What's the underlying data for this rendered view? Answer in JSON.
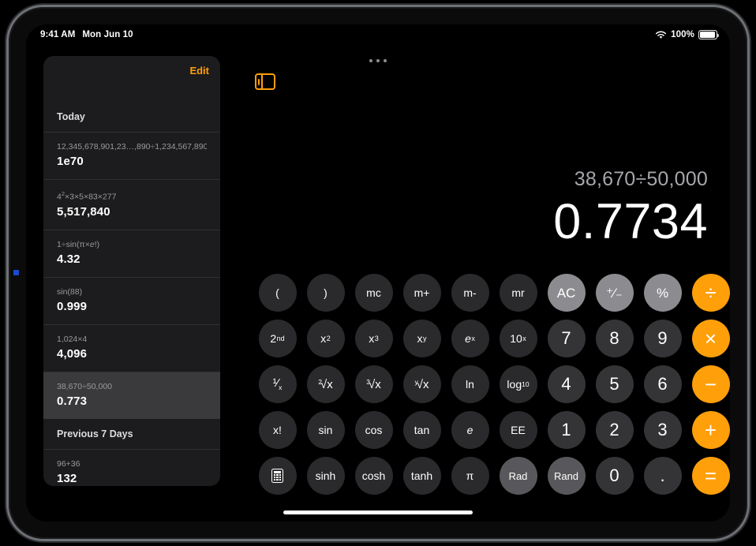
{
  "status_bar": {
    "time": "9:41 AM",
    "date": "Mon Jun 10",
    "wifi_icon": "wifi-icon",
    "battery_percent": "100%",
    "battery_icon": "battery-icon"
  },
  "multitask": {
    "icon": "multitasking-dots-icon"
  },
  "sidebar": {
    "edit_label": "Edit",
    "toggle_icon": "sidebar-toggle-icon",
    "sections": [
      {
        "title": "Today",
        "entries": [
          {
            "expression": "12,345,678,901,23…,890÷1,234,567,890",
            "result": "1e70",
            "selected": false
          },
          {
            "expression": "4²×3×5×83×277",
            "result": "5,517,840",
            "selected": false
          },
          {
            "expression": "1÷sin(π×e!)",
            "result": "4.32",
            "selected": false
          },
          {
            "expression": "sin(88)",
            "result": "0.999",
            "selected": false
          },
          {
            "expression": "1,024×4",
            "result": "4,096",
            "selected": false
          },
          {
            "expression": "38,670÷50,000",
            "result": "0.773",
            "selected": true
          }
        ]
      },
      {
        "title": "Previous 7 Days",
        "entries": [
          {
            "expression": "96+36",
            "result": "132",
            "selected": false
          }
        ]
      }
    ]
  },
  "display": {
    "expression": "38,670÷50,000",
    "result": "0.7734"
  },
  "colors": {
    "accent_orange": "#ff9f0a",
    "util_gray": "#8c8c90",
    "key_dark": "#2a2a2c",
    "digit_gray": "#343437",
    "sidebar_bg": "#1c1c1e",
    "row_selected": "#3a3a3c"
  },
  "keypad": {
    "rows": [
      [
        {
          "label": "(",
          "name": "key-open-paren",
          "style": "func"
        },
        {
          "label": ")",
          "name": "key-close-paren",
          "style": "func"
        },
        {
          "label": "mc",
          "name": "key-mc",
          "style": "func"
        },
        {
          "label": "m+",
          "name": "key-m-plus",
          "style": "func"
        },
        {
          "label": "m-",
          "name": "key-m-minus",
          "style": "func"
        },
        {
          "label": "mr",
          "name": "key-mr",
          "style": "func"
        },
        {
          "label": "AC",
          "name": "key-all-clear",
          "style": "util"
        },
        {
          "label": "⁺⁄₋",
          "name": "key-plus-minus",
          "style": "util"
        },
        {
          "label": "%",
          "name": "key-percent",
          "style": "util"
        },
        {
          "label": "÷",
          "name": "key-divide",
          "style": "op"
        }
      ],
      [
        {
          "label": "2nd",
          "name": "key-second",
          "style": "func",
          "html": "2<sup>nd</sup>"
        },
        {
          "label": "x²",
          "name": "key-x-squared",
          "style": "func",
          "html": "x<sup>2</sup>"
        },
        {
          "label": "x³",
          "name": "key-x-cubed",
          "style": "func",
          "html": "x<sup>3</sup>"
        },
        {
          "label": "xʸ",
          "name": "key-x-power-y",
          "style": "func",
          "html": "x<sup>y</sup>"
        },
        {
          "label": "eˣ",
          "name": "key-e-power-x",
          "style": "func",
          "html": "<i>e</i><sup>x</sup>"
        },
        {
          "label": "10ˣ",
          "name": "key-ten-power-x",
          "style": "func",
          "html": "10<sup>x</sup>"
        },
        {
          "label": "7",
          "name": "key-7",
          "style": "digit"
        },
        {
          "label": "8",
          "name": "key-8",
          "style": "digit"
        },
        {
          "label": "9",
          "name": "key-9",
          "style": "digit"
        },
        {
          "label": "×",
          "name": "key-multiply",
          "style": "op"
        }
      ],
      [
        {
          "label": "1/x",
          "name": "key-reciprocal",
          "style": "func",
          "html": "<span class=\"frac\">¹⁄<sub>x</sub></span>"
        },
        {
          "label": "²√x",
          "name": "key-square-root",
          "style": "func",
          "html": "<span class=\"radic\"><span class=\"idx\">2</span><span class=\"rad\">√x</span></span>"
        },
        {
          "label": "³√x",
          "name": "key-cube-root",
          "style": "func",
          "html": "<span class=\"radic\"><span class=\"idx\">3</span><span class=\"rad\">√x</span></span>"
        },
        {
          "label": "ʸ√x",
          "name": "key-y-root",
          "style": "func",
          "html": "<span class=\"radic\"><span class=\"idx\">y</span><span class=\"rad\">√x</span></span>"
        },
        {
          "label": "ln",
          "name": "key-natural-log",
          "style": "func"
        },
        {
          "label": "log10",
          "name": "key-log-base-10",
          "style": "func",
          "html": "log<sub>10</sub>"
        },
        {
          "label": "4",
          "name": "key-4",
          "style": "digit"
        },
        {
          "label": "5",
          "name": "key-5",
          "style": "digit"
        },
        {
          "label": "6",
          "name": "key-6",
          "style": "digit"
        },
        {
          "label": "−",
          "name": "key-subtract",
          "style": "op"
        }
      ],
      [
        {
          "label": "x!",
          "name": "key-factorial",
          "style": "func"
        },
        {
          "label": "sin",
          "name": "key-sin",
          "style": "func"
        },
        {
          "label": "cos",
          "name": "key-cos",
          "style": "func"
        },
        {
          "label": "tan",
          "name": "key-tan",
          "style": "func"
        },
        {
          "label": "e",
          "name": "key-euler",
          "style": "func",
          "html": "<i>e</i>"
        },
        {
          "label": "EE",
          "name": "key-ee",
          "style": "func"
        },
        {
          "label": "1",
          "name": "key-1",
          "style": "digit"
        },
        {
          "label": "2",
          "name": "key-2",
          "style": "digit"
        },
        {
          "label": "3",
          "name": "key-3",
          "style": "digit"
        },
        {
          "label": "+",
          "name": "key-add",
          "style": "op"
        }
      ],
      [
        {
          "label": "calculator",
          "name": "key-calculator-mode",
          "style": "func",
          "icon": "calculator-icon"
        },
        {
          "label": "sinh",
          "name": "key-sinh",
          "style": "func"
        },
        {
          "label": "cosh",
          "name": "key-cosh",
          "style": "func"
        },
        {
          "label": "tanh",
          "name": "key-tanh",
          "style": "func"
        },
        {
          "label": "π",
          "name": "key-pi",
          "style": "func"
        },
        {
          "label": "Rad",
          "name": "key-radians",
          "style": "toggle"
        },
        {
          "label": "Rand",
          "name": "key-random",
          "style": "toggle"
        },
        {
          "label": "0",
          "name": "key-0",
          "style": "digit"
        },
        {
          "label": ".",
          "name": "key-decimal",
          "style": "digit"
        },
        {
          "label": "=",
          "name": "key-equals",
          "style": "op"
        }
      ]
    ]
  }
}
